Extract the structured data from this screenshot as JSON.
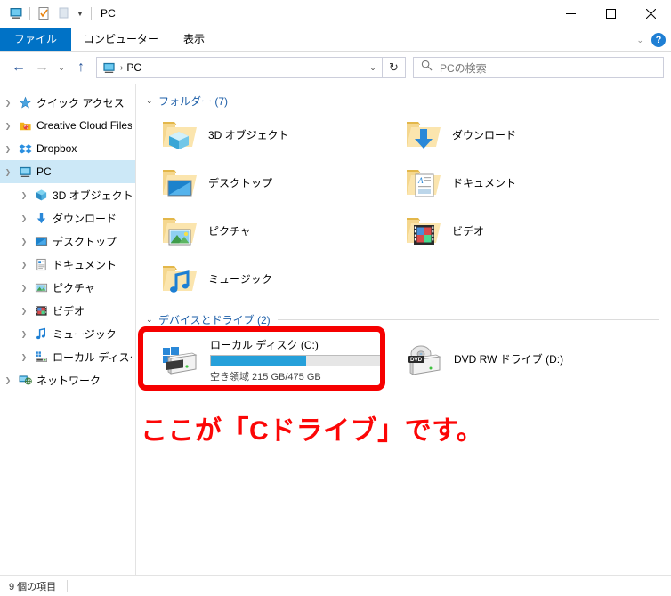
{
  "window": {
    "title": "PC",
    "quick_access": [
      {
        "name": "pc-icon",
        "label": "PC"
      },
      {
        "name": "properties-icon",
        "label": "プロパティ"
      },
      {
        "name": "new-folder-icon",
        "label": "新しいフォルダー"
      }
    ],
    "controls": {
      "minimize": "─",
      "maximize": "☐",
      "close": "✕"
    }
  },
  "ribbon": {
    "tabs": [
      {
        "label": "ファイル",
        "active": true
      },
      {
        "label": "コンピューター",
        "active": false
      },
      {
        "label": "表示",
        "active": false
      }
    ],
    "help_label": "?",
    "expand_caret": "⌄"
  },
  "addressbar": {
    "back": "←",
    "forward": "→",
    "recent": "⌄",
    "up": "↑",
    "path": "PC",
    "path_separator": "›",
    "dropdown_caret": "⌄",
    "refresh": "↻",
    "search_placeholder": "PCの検索",
    "search_value": ""
  },
  "sidebar": {
    "items": [
      {
        "label": "クイック アクセス",
        "icon": "star-icon",
        "level": 1,
        "expandable": true,
        "selected": false
      },
      {
        "label": "Creative Cloud Files",
        "icon": "creative-cloud-icon",
        "level": 1,
        "expandable": true,
        "selected": false
      },
      {
        "label": "Dropbox",
        "icon": "dropbox-icon",
        "level": 1,
        "expandable": true,
        "selected": false
      },
      {
        "label": "PC",
        "icon": "pc-icon",
        "level": 1,
        "expandable": true,
        "selected": true
      },
      {
        "label": "3D オブジェクト",
        "icon": "3d-objects-icon",
        "level": 2,
        "expandable": true,
        "selected": false
      },
      {
        "label": "ダウンロード",
        "icon": "downloads-icon",
        "level": 2,
        "expandable": true,
        "selected": false
      },
      {
        "label": "デスクトップ",
        "icon": "desktop-icon",
        "level": 2,
        "expandable": true,
        "selected": false
      },
      {
        "label": "ドキュメント",
        "icon": "documents-icon",
        "level": 2,
        "expandable": true,
        "selected": false
      },
      {
        "label": "ピクチャ",
        "icon": "pictures-icon",
        "level": 2,
        "expandable": true,
        "selected": false
      },
      {
        "label": "ビデオ",
        "icon": "videos-icon",
        "level": 2,
        "expandable": true,
        "selected": false
      },
      {
        "label": "ミュージック",
        "icon": "music-icon",
        "level": 2,
        "expandable": true,
        "selected": false
      },
      {
        "label": "ローカル ディスク (C:)",
        "icon": "hard-drive-icon",
        "level": 2,
        "expandable": true,
        "selected": false
      },
      {
        "label": "ネットワーク",
        "icon": "network-icon",
        "level": 1,
        "expandable": true,
        "selected": false
      }
    ]
  },
  "main": {
    "folders_group": {
      "title": "フォルダー (7)",
      "chevron": "⌄",
      "items": [
        {
          "label": "3D オブジェクト",
          "icon": "folder-3d-objects-icon"
        },
        {
          "label": "ダウンロード",
          "icon": "folder-downloads-icon"
        },
        {
          "label": "デスクトップ",
          "icon": "folder-desktop-icon"
        },
        {
          "label": "ドキュメント",
          "icon": "folder-documents-icon"
        },
        {
          "label": "ピクチャ",
          "icon": "folder-pictures-icon"
        },
        {
          "label": "ビデオ",
          "icon": "folder-videos-icon"
        },
        {
          "label": "ミュージック",
          "icon": "folder-music-icon"
        }
      ]
    },
    "devices_group": {
      "title": "デバイスとドライブ (2)",
      "chevron": "⌄",
      "items": [
        {
          "label": "ローカル ディスク (C:)",
          "icon": "windows-hard-drive-icon",
          "free_space_text": "空き領域 215 GB/475 GB",
          "free_gb": 215,
          "total_gb": 475,
          "used_percent": 55,
          "bar_color": "#26a0da"
        },
        {
          "label": "DVD RW ドライブ (D:)",
          "icon": "dvd-drive-icon",
          "free_space_text": "",
          "used_percent": 0
        }
      ]
    }
  },
  "annotation": {
    "note_text": "ここが「Cドライブ」です。",
    "color": "#fc0606",
    "box_target": "ローカル ディスク (C:)"
  },
  "statusbar": {
    "item_count_text": "9 個の項目"
  }
}
